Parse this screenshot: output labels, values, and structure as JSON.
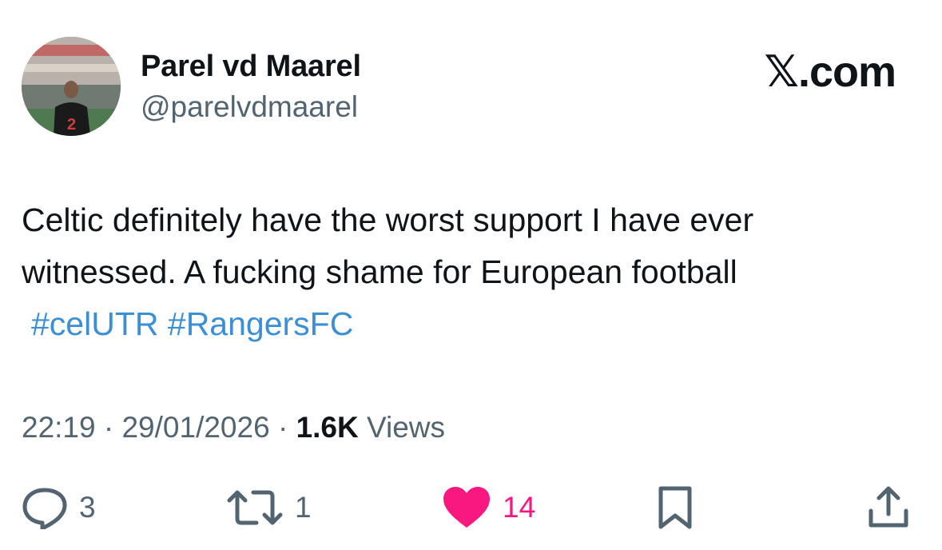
{
  "author": {
    "name": "Parel vd Maarel",
    "handle": "@parelvdmaarel",
    "avatar_icon": "avatar-photo-icon"
  },
  "brand": "𝕏.com",
  "tweet": {
    "lines": [
      "Celtic definitely have the worst support I have ever",
      "witnessed. A fucking shame for European football"
    ],
    "hashtags": [
      "#celUTR",
      "#RangersFC"
    ]
  },
  "meta": {
    "time": "22:19",
    "separator": "·",
    "date": "29/01/2026",
    "views_count": "1.6K",
    "views_label": "Views"
  },
  "actions": {
    "reply_count": "3",
    "retweet_count": "1",
    "like_count": "14",
    "like_color": "#f91880",
    "hashtag_color": "#3b8fd6",
    "icons": [
      "reply-icon",
      "retweet-icon",
      "heart-icon",
      "bookmark-icon",
      "share-icon"
    ]
  }
}
